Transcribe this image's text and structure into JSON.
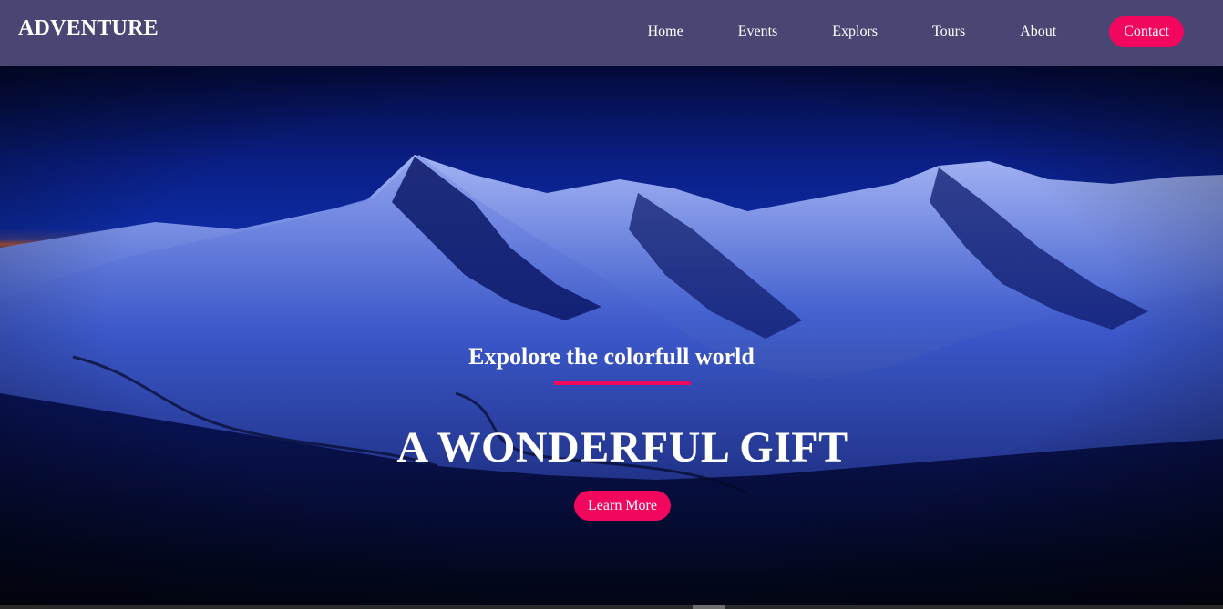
{
  "header": {
    "brand": "ADVENTURE",
    "nav": [
      {
        "label": "Home"
      },
      {
        "label": "Events"
      },
      {
        "label": "Explors"
      },
      {
        "label": "Tours"
      },
      {
        "label": "About"
      }
    ],
    "contact_label": "Contact"
  },
  "hero": {
    "subtitle": "Expolore the colorfull world",
    "headline": "A WONDERFUL GIFT",
    "cta_label": "Learn More"
  },
  "colors": {
    "navbar_bg": "#4a4674",
    "accent": "#f2075f",
    "text": "#ffffff"
  }
}
